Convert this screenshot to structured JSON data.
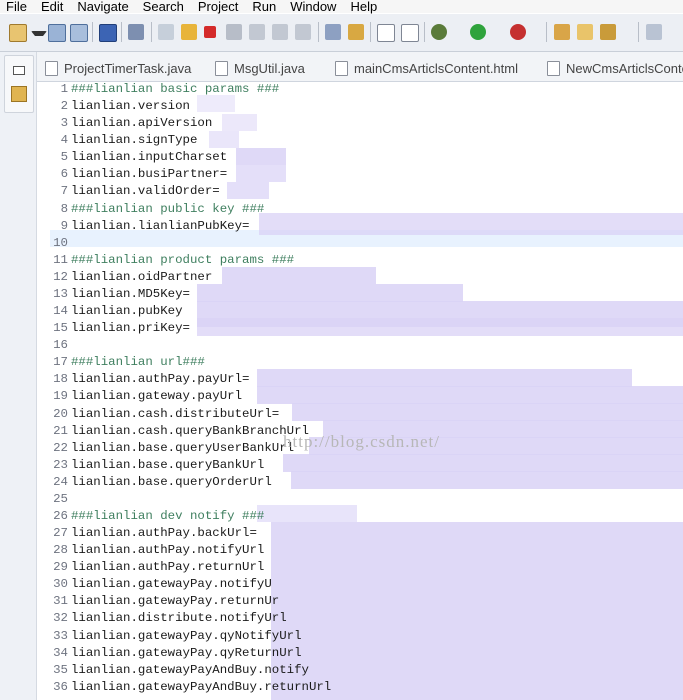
{
  "menu": [
    "File",
    "Edit",
    "Navigate",
    "Search",
    "Project",
    "Run",
    "Window",
    "Help"
  ],
  "toolbar_icons": [
    "new-icon",
    "dropdown-icon",
    "save-icon",
    "save-all-icon",
    "outline-icon",
    "skip-breakpoints-icon",
    "resume-icon",
    "suspend-icon",
    "terminate-icon",
    "disconnect-icon",
    "step-into-icon",
    "step-over-icon",
    "step-return-icon",
    "drop-frame-icon",
    "use-step-filters-icon",
    "toggle-mark-icon",
    "sort-icon",
    "debug-icon",
    "run-icon",
    "run-external-icon",
    "new-package-icon",
    "open-folder-icon",
    "brush-icon",
    "next-annotation-icon"
  ],
  "tabs": [
    {
      "label": "ProjectTimerTask.java"
    },
    {
      "label": "MsgUtil.java"
    },
    {
      "label": "mainCmsArticlsContent.html"
    },
    {
      "label": "NewCmsArticlsConte"
    }
  ],
  "editor": {
    "lines": [
      {
        "num": "1",
        "text": "###lianlian basic params ###",
        "comment": true
      },
      {
        "num": "2",
        "text": "lianlian.version",
        "comment": false
      },
      {
        "num": "3",
        "text": "lianlian.apiVersion",
        "comment": false
      },
      {
        "num": "4",
        "text": "lianlian.signType",
        "comment": false
      },
      {
        "num": "5",
        "text": "lianlian.inputCharset",
        "comment": false
      },
      {
        "num": "6",
        "text": "lianlian.busiPartner=",
        "comment": false
      },
      {
        "num": "7",
        "text": "lianlian.validOrder=",
        "comment": false
      },
      {
        "num": "8",
        "text": "###lianlian public key ###",
        "comment": true
      },
      {
        "num": "9",
        "text": "lianlian.lianlianPubKey=",
        "comment": false
      },
      {
        "num": "10",
        "text": "",
        "comment": false
      },
      {
        "num": "11",
        "text": "###lianlian product params ###",
        "comment": true
      },
      {
        "num": "12",
        "text": "lianlian.oidPartner",
        "comment": false
      },
      {
        "num": "13",
        "text": "lianlian.MD5Key=",
        "comment": false
      },
      {
        "num": "14",
        "text": "lianlian.pubKey",
        "comment": false
      },
      {
        "num": "15",
        "text": "lianlian.priKey=",
        "comment": false
      },
      {
        "num": "16",
        "text": "",
        "comment": false
      },
      {
        "num": "17",
        "text": "###lianlian url###",
        "comment": true
      },
      {
        "num": "18",
        "text": "lianlian.authPay.payUrl=",
        "comment": false
      },
      {
        "num": "19",
        "text": "lianlian.gateway.payUrl",
        "comment": false
      },
      {
        "num": "20",
        "text": "lianlian.cash.distributeUrl=",
        "comment": false
      },
      {
        "num": "21",
        "text": "lianlian.cash.queryBankBranchUrl",
        "comment": false
      },
      {
        "num": "22",
        "text": "lianlian.base.queryUserBankUrl",
        "comment": false
      },
      {
        "num": "23",
        "text": "lianlian.base.queryBankUrl",
        "comment": false
      },
      {
        "num": "24",
        "text": "lianlian.base.queryOrderUrl",
        "comment": false
      },
      {
        "num": "25",
        "text": "",
        "comment": false
      },
      {
        "num": "26",
        "text": "###lianlian dev notify ###",
        "comment": true
      },
      {
        "num": "27",
        "text": "lianlian.authPay.backUrl=",
        "comment": false
      },
      {
        "num": "28",
        "text": "lianlian.authPay.notifyUrl",
        "comment": false
      },
      {
        "num": "29",
        "text": "lianlian.authPay.returnUrl",
        "comment": false
      },
      {
        "num": "30",
        "text": "lianlian.gatewayPay.notifyU",
        "comment": false
      },
      {
        "num": "31",
        "text": "lianlian.gatewayPay.returnUr",
        "comment": false
      },
      {
        "num": "32",
        "text": "lianlian.distribute.notifyUrl",
        "comment": false
      },
      {
        "num": "33",
        "text": "lianlian.gatewayPay.qyNotifyUrl",
        "comment": false
      },
      {
        "num": "34",
        "text": "lianlian.gatewayPay.qyReturnUrl",
        "comment": false
      },
      {
        "num": "35",
        "text": "lianlian.gatewayPayAndBuy.notify",
        "comment": false
      },
      {
        "num": "36",
        "text": "lianlian.gatewayPayAndBuy.returnUrl",
        "comment": false
      }
    ]
  },
  "watermark": "http://blog.csdn.net/",
  "colors": {
    "comment": "#3f7f5f",
    "redacted": "#d9d2f6",
    "current_line": "#e8f2fe"
  }
}
